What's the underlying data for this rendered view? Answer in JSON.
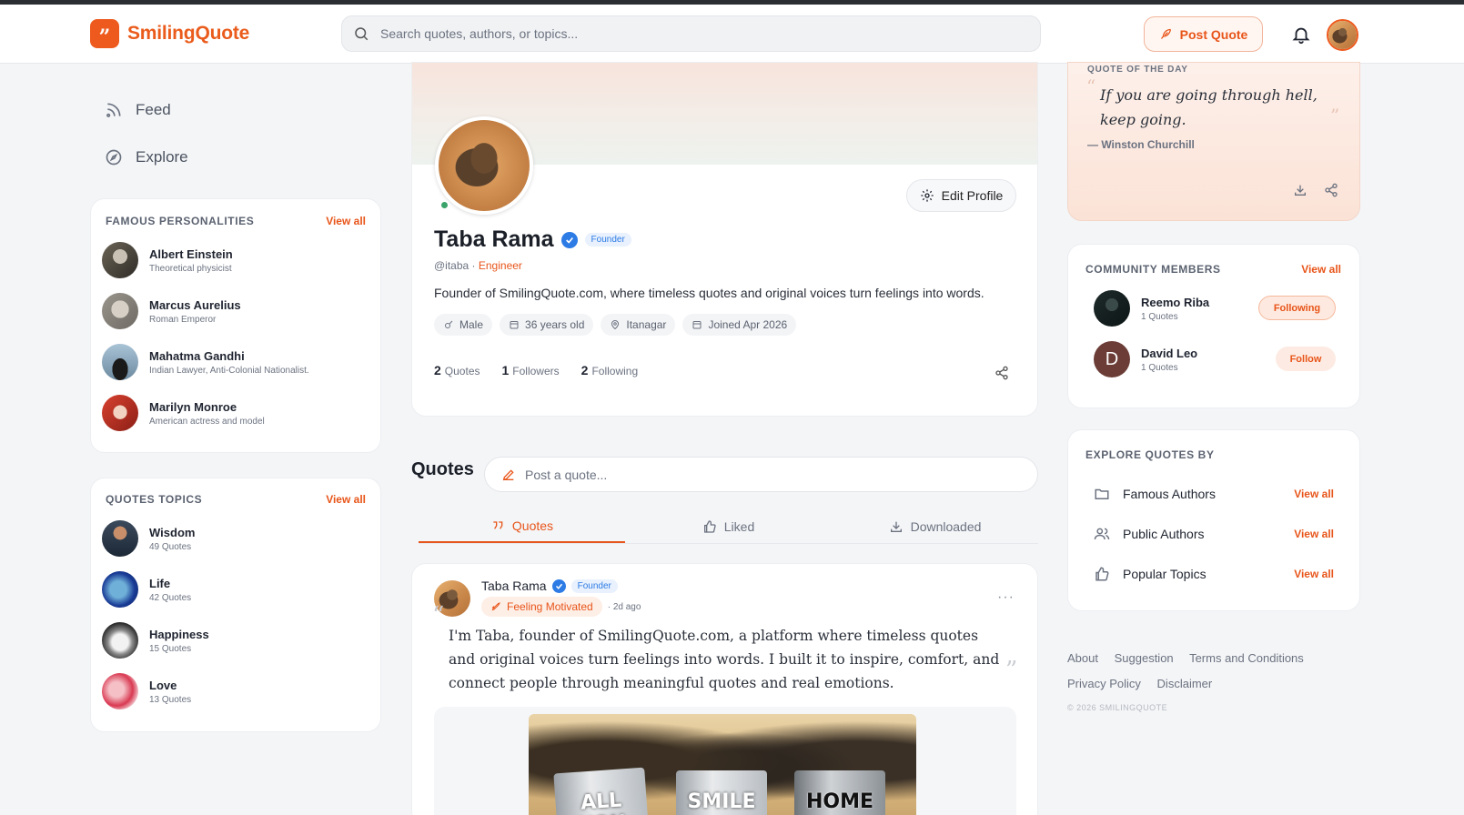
{
  "header": {
    "logo_text": "SmilingQuote",
    "logo_mark": "”",
    "search_placeholder": "Search quotes, authors, or topics...",
    "post_button": "Post Quote"
  },
  "nav": {
    "items": [
      {
        "label": "Feed",
        "icon": "rss-icon"
      },
      {
        "label": "Explore",
        "icon": "compass-icon"
      }
    ]
  },
  "famous": {
    "title": "Famous Personalities",
    "view_all": "View all",
    "people": [
      {
        "name": "Albert Einstein",
        "sub": "Theoretical physicist"
      },
      {
        "name": "Marcus Aurelius",
        "sub": "Roman Emperor"
      },
      {
        "name": "Mahatma Gandhi",
        "sub": "Indian Lawyer, Anti-Colonial Nationalist."
      },
      {
        "name": "Marilyn Monroe",
        "sub": "American actress and model"
      }
    ]
  },
  "topics": {
    "title": "Quotes Topics",
    "view_all": "View all",
    "items": [
      {
        "name": "Wisdom",
        "sub": "49 Quotes"
      },
      {
        "name": "Life",
        "sub": "42 Quotes"
      },
      {
        "name": "Happiness",
        "sub": "15 Quotes"
      },
      {
        "name": "Love",
        "sub": "13 Quotes"
      }
    ]
  },
  "profile": {
    "name": "Taba Rama",
    "badge": "Founder",
    "handle": "@itaba · ",
    "occupation": "Engineer",
    "edit_button": "Edit Profile",
    "bio": "Founder of SmilingQuote.com, where timeless quotes and original voices turn feelings into words.",
    "chips": [
      "Male",
      "36 years old",
      "Itanagar",
      "Joined Apr 2026"
    ],
    "stats": [
      {
        "count": "2",
        "label": "Quotes"
      },
      {
        "count": "1",
        "label": "Followers"
      },
      {
        "count": "2",
        "label": "Following"
      }
    ]
  },
  "quotes_section": {
    "title": "Quotes",
    "post_placeholder": "Post a quote...",
    "tabs": [
      "Quotes",
      "Liked",
      "Downloaded"
    ],
    "active_tab": "Quotes"
  },
  "post": {
    "author": "Taba Rama",
    "badge": "Founder",
    "feeling": "Feeling Motivated",
    "ago": "· 2d ago",
    "text": "I'm Taba, founder of SmilingQuote.com, a platform where timeless quotes and original voices turn feelings into words. I built it to inspire, comfort, and connect people through meaningful quotes and real emotions.",
    "image_words": [
      "ALL YOU",
      "SMILE",
      "HOME"
    ]
  },
  "qotd": {
    "label": "QUOTE OF THE DAY",
    "text": "If you are going through hell, keep going.",
    "author": "— Winston Churchill"
  },
  "community": {
    "title": "Community Members",
    "view_all": "View all",
    "members": [
      {
        "name": "Reemo Riba",
        "sub": "1 Quotes",
        "action": "Following"
      },
      {
        "name": "David Leo",
        "sub": "1 Quotes",
        "action": "Follow",
        "initial": "D"
      }
    ]
  },
  "explore": {
    "title": "Explore Quotes By",
    "items": [
      {
        "label": "Famous Authors",
        "action": "View all"
      },
      {
        "label": "Public Authors",
        "action": "View all"
      },
      {
        "label": "Popular Topics",
        "action": "View all"
      }
    ]
  },
  "footer": {
    "links": [
      "About",
      "Suggestion",
      "Terms and Conditions",
      "Privacy Policy",
      "Disclaimer"
    ],
    "copyright": "© 2026 SMILINGQUOTE"
  },
  "colors": {
    "accent": "#e8551a",
    "verified": "#2d7be5",
    "online": "#3aa36a"
  }
}
